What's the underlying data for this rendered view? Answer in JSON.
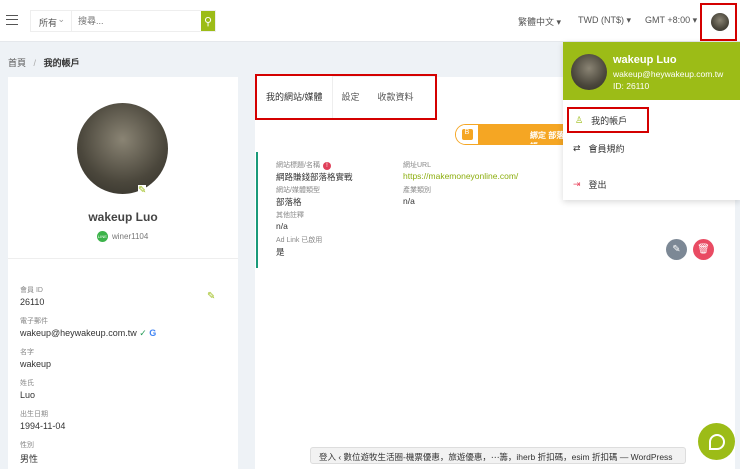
{
  "header": {
    "category": "所有",
    "search_placeholder": "搜尋...",
    "language": "繁體中文 ▾",
    "currency": "TWD (NT$) ▾",
    "timezone": "GMT +8:00 ▾"
  },
  "breadcrumb": {
    "home": "首頁",
    "separator": "/",
    "current": "我的帳戶"
  },
  "profile": {
    "name": "wakeup Luo",
    "line_id": "winer1104",
    "line_badge": "LINE",
    "fields": [
      {
        "label": "會員 ID",
        "value": "26110"
      },
      {
        "label": "電子郵件",
        "value": "wakeup@heywakeup.com.tw"
      },
      {
        "label": "名字",
        "value": "wakeup"
      },
      {
        "label": "姓氏",
        "value": "Luo"
      },
      {
        "label": "出生日期",
        "value": "1994-11-04"
      },
      {
        "label": "性別",
        "value": "男性"
      }
    ]
  },
  "tabs": [
    {
      "label": "我的網站/媒體"
    },
    {
      "label": "設定"
    },
    {
      "label": "收款資料"
    }
  ],
  "bind_button": {
    "label": "綁定 部落格 帳"
  },
  "site": {
    "title_label": "網站標題/名稱",
    "title_value": "網路賺錢部落格實戰",
    "url_label": "網址URL",
    "url_value": "https://makemoneyonline.com/",
    "type_label": "網站/媒體類型",
    "type_value": "部落格",
    "industry_label": "產業類別",
    "industry_value": "n/a",
    "notes_label": "其他註釋",
    "notes_value": "n/a",
    "adlink_label": "Ad Link 已啟用",
    "adlink_value": "是"
  },
  "dropdown": {
    "name": "wakeup Luo",
    "email": "wakeup@heywakeup.com.tw",
    "id": "ID: 26110",
    "items": [
      {
        "label": "我的帳戶"
      },
      {
        "label": "會員規約"
      },
      {
        "label": "登出"
      }
    ]
  },
  "tooltip": "登入 ‹ 數位遊牧生活圈-機票優惠，旅遊優惠，⋯籌，iherb 折扣碼，esim 折扣碼 — WordPress",
  "colors": {
    "brand": "#9cbc17",
    "accent": "#f5a623",
    "highlight": "#d40000"
  }
}
